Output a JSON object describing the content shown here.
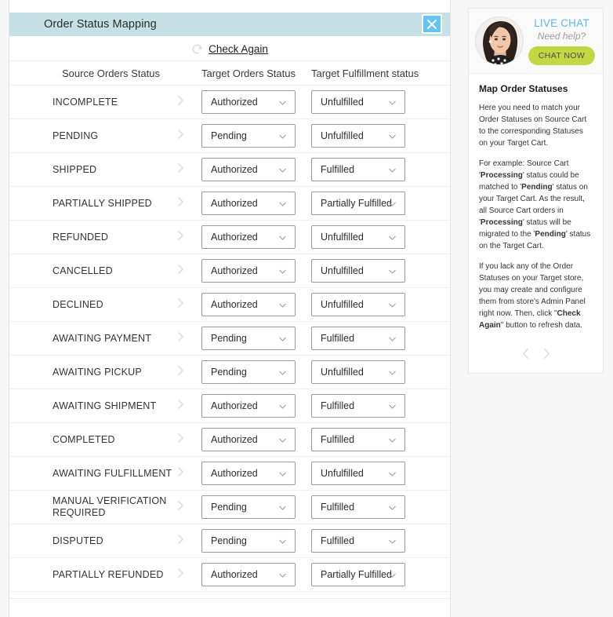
{
  "panel": {
    "title": "Order Status Mapping",
    "close_icon": "close-icon",
    "check_again_label": "Check Again",
    "spinner_icon": "refresh-spinner-icon",
    "columns": {
      "source": "Source Orders Status",
      "target_order": "Target Orders Status",
      "target_fulfillment": "Target Fulfillment status"
    },
    "rows": [
      {
        "source": "INCOMPLETE",
        "target_order": "Authorized",
        "fulfillment": "Unfulfilled"
      },
      {
        "source": "PENDING",
        "target_order": "Pending",
        "fulfillment": "Unfulfilled"
      },
      {
        "source": "SHIPPED",
        "target_order": "Authorized",
        "fulfillment": "Fulfilled"
      },
      {
        "source": "PARTIALLY SHIPPED",
        "target_order": "Authorized",
        "fulfillment": "Partially Fulfilled"
      },
      {
        "source": "REFUNDED",
        "target_order": "Authorized",
        "fulfillment": "Unfulfilled"
      },
      {
        "source": "CANCELLED",
        "target_order": "Authorized",
        "fulfillment": "Unfulfilled"
      },
      {
        "source": "DECLINED",
        "target_order": "Authorized",
        "fulfillment": "Unfulfilled"
      },
      {
        "source": "AWAITING PAYMENT",
        "target_order": "Pending",
        "fulfillment": "Fulfilled"
      },
      {
        "source": "AWAITING PICKUP",
        "target_order": "Pending",
        "fulfillment": "Unfulfilled"
      },
      {
        "source": "AWAITING SHIPMENT",
        "target_order": "Authorized",
        "fulfillment": "Fulfilled"
      },
      {
        "source": "COMPLETED",
        "target_order": "Authorized",
        "fulfillment": "Fulfilled"
      },
      {
        "source": "AWAITING FULFILLMENT",
        "target_order": "Authorized",
        "fulfillment": "Unfulfilled"
      },
      {
        "source": "MANUAL VERIFICATION REQUIRED",
        "target_order": "Pending",
        "fulfillment": "Fulfilled"
      },
      {
        "source": "DISPUTED",
        "target_order": "Pending",
        "fulfillment": "Fulfilled"
      },
      {
        "source": "PARTIALLY REFUNDED",
        "target_order": "Authorized",
        "fulfillment": "Partially Fulfilled"
      }
    ]
  },
  "sidebar": {
    "live_chat_label": "LIVE CHAT",
    "need_help_label": "Need help?",
    "chat_now_label": "CHAT NOW",
    "avatar_icon": "agent-avatar-photo",
    "help_title": "Map Order Statuses",
    "help_p1": "Here you need to match your Order Statuses on Source Cart to the corresponding Statuses on your Target Cart.",
    "help_p2_a": "For example: Source Cart '",
    "help_p2_b1": "Processing",
    "help_p2_c": "' status could be matched to '",
    "help_p2_b2": "Pending",
    "help_p2_d": "' status on your Target Cart. As the result, all Source Cart orders in '",
    "help_p2_b3": "Processing",
    "help_p2_e": "' status will be migrated to the '",
    "help_p2_b4": "Pending",
    "help_p2_f": "' status on the Target Cart.",
    "help_p3_a": "If you lack any of the Order Statuses on your Target store, you may create and configure them from store's Admin Panel right now. Then, click \"",
    "help_p3_b": "Check Again",
    "help_p3_c": "\" button to refresh data.",
    "prev_icon": "chevron-left-icon",
    "next_icon": "chevron-right-icon"
  },
  "colors": {
    "header_band": "#c5e1e6",
    "close_button": "#63c5f5",
    "chat_now": "#c3d643",
    "live_chat_text": "#5bb9e8",
    "page_background": "#f7f7f7"
  }
}
